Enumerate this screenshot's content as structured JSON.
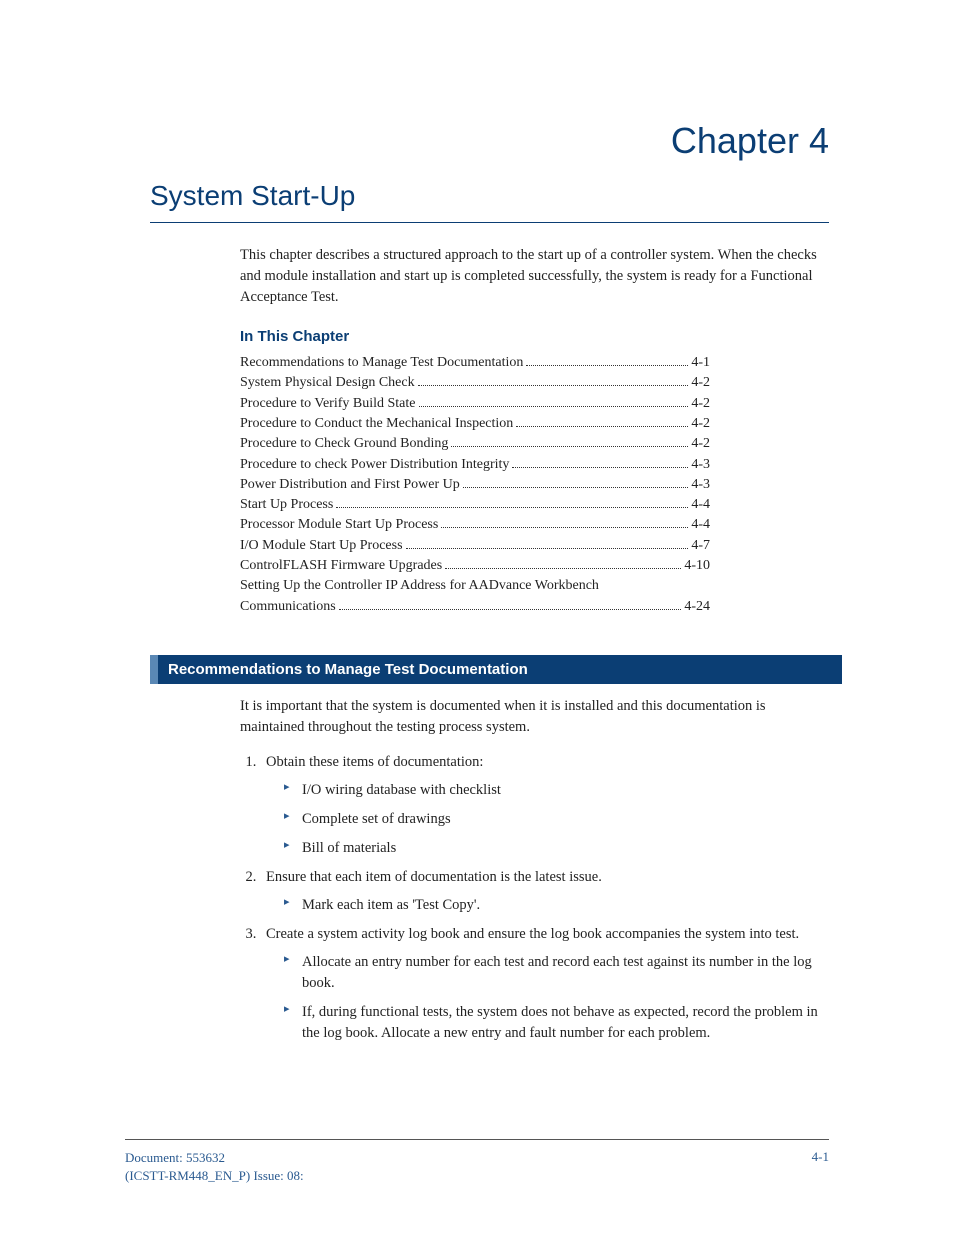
{
  "chapter": {
    "number": "Chapter 4",
    "title": "System Start-Up",
    "intro": "This chapter describes a structured approach to the start up of a controller system. When the checks and module installation and start up is completed successfully, the system is ready for a Functional Acceptance Test.",
    "in_this_chapter_label": "In This Chapter"
  },
  "toc": [
    {
      "label": "Recommendations to Manage Test Documentation",
      "page": "4-1"
    },
    {
      "label": "System Physical Design Check",
      "page": "4-2"
    },
    {
      "label": "Procedure to Verify Build State",
      "page": "4-2"
    },
    {
      "label": "Procedure to Conduct the Mechanical Inspection",
      "page": "4-2"
    },
    {
      "label": "Procedure to Check Ground Bonding",
      "page": "4-2"
    },
    {
      "label": "Procedure to check Power Distribution Integrity",
      "page": "4-3"
    },
    {
      "label": "Power Distribution and First Power Up",
      "page": "4-3"
    },
    {
      "label": "Start Up Process",
      "page": "4-4"
    },
    {
      "label": "Processor Module Start Up Process",
      "page": "4-4"
    },
    {
      "label": "I/O Module Start Up Process",
      "page": "4-7"
    },
    {
      "label": "ControlFLASH Firmware Upgrades",
      "page": "4-10"
    },
    {
      "label": "Setting Up the Controller IP Address for AADvance Workbench Communications",
      "page": "4-24",
      "wrap": true
    }
  ],
  "section": {
    "heading": "Recommendations to Manage Test Documentation",
    "intro": "It is important that the system is documented when it is installed and this documentation is maintained throughout the testing process system.",
    "steps": [
      {
        "text": "Obtain these items of documentation:",
        "bullets": [
          "I/O wiring database with checklist",
          "Complete set of drawings",
          "Bill of materials"
        ]
      },
      {
        "text": "Ensure that each item of documentation is the latest issue.",
        "bullets": [
          "Mark each item as 'Test Copy'."
        ]
      },
      {
        "text": "Create a system activity log book and ensure the log book accompanies the system into test.",
        "bullets": [
          "Allocate an entry number for each test and record each test against its number in the log book.",
          "If, during functional tests, the system does not behave as expected, record the problem in the log book. Allocate a new entry and fault number for each problem."
        ]
      }
    ]
  },
  "footer": {
    "doc": "Document: 553632",
    "issue": "(ICSTT-RM448_EN_P) Issue: 08:",
    "page": "4-1"
  }
}
